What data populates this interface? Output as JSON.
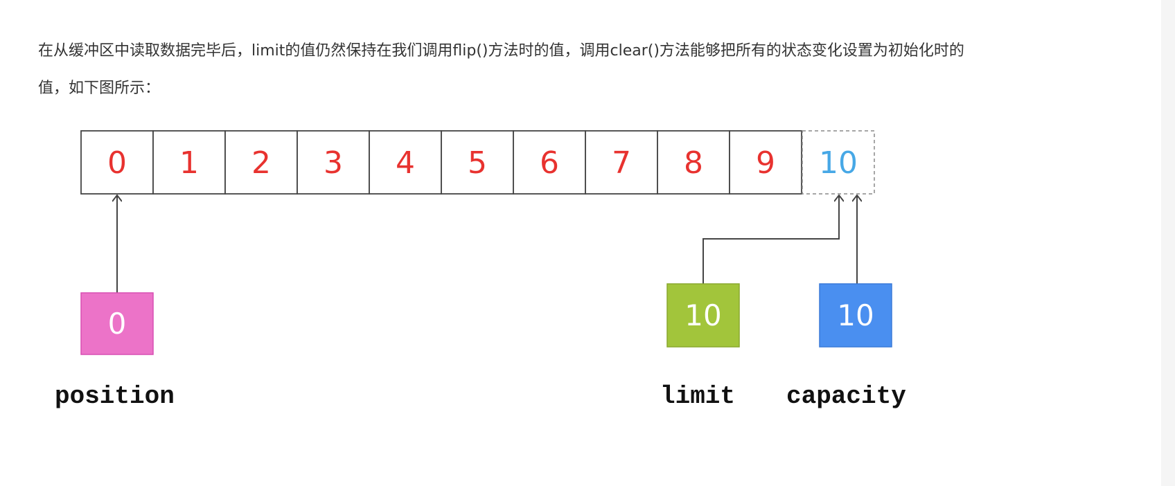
{
  "paragraph": {
    "line1": "在从缓冲区中读取数据完毕后，limit的值仍然保持在我们调用flip()方法时的值，调用clear()方法能够把所有的状态变化设置为初始化时的",
    "line2": "值，如下图所示："
  },
  "diagram": {
    "cells": [
      "0",
      "1",
      "2",
      "3",
      "4",
      "5",
      "6",
      "7",
      "8",
      "9"
    ],
    "extra_cell": "10",
    "markers": {
      "position": {
        "value": "0",
        "label": "position",
        "color": "#ec73c8",
        "index": 0
      },
      "limit": {
        "value": "10",
        "label": "limit",
        "color": "#a2c53b",
        "index": 10
      },
      "capacity": {
        "value": "10",
        "label": "capacity",
        "color": "#4a8ff0",
        "index": 10
      }
    },
    "colors": {
      "cell_text": "#e8322f",
      "extra_text": "#47a8e6",
      "border": "#444444"
    }
  }
}
